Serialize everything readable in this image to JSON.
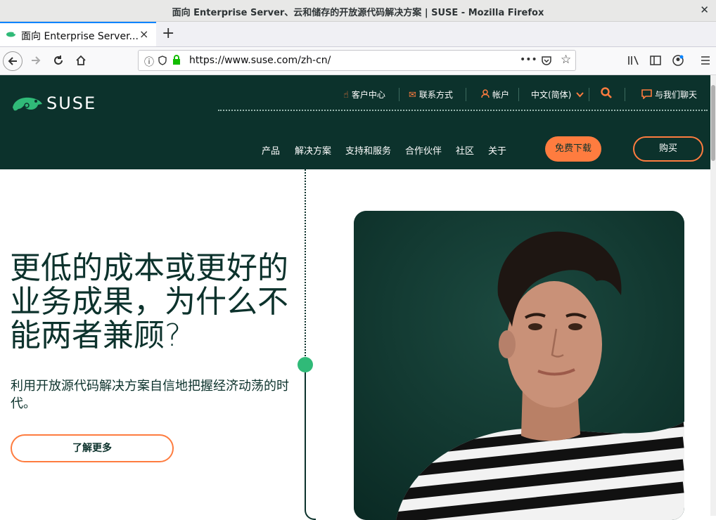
{
  "window": {
    "title": "面向 Enterprise Server、云和储存的开放源代码解决方案 | SUSE - Mozilla Firefox"
  },
  "tab": {
    "label": "面向 Enterprise Server...",
    "close": "×",
    "new": "+"
  },
  "address": {
    "url": "https://www.suse.com/zh-cn/",
    "more": "•••"
  },
  "brand": {
    "name": "SUSE"
  },
  "utility": {
    "customer_center": "客户中心",
    "contact": "联系方式",
    "account": "帐户",
    "language": "中文(简体)",
    "chat": "与我们聊天"
  },
  "nav": [
    "产品",
    "解决方案",
    "支持和服务",
    "合作伙伴",
    "社区",
    "关于"
  ],
  "buttons": {
    "free_download": "免费下载",
    "buy": "购买",
    "learn_more": "了解更多"
  },
  "hero": {
    "heading": "更低的成本或更好的业务成果，为什么不能两者兼顾?",
    "subheading": "利用开放源代码解决方案自信地把握经济动荡的时代。"
  },
  "colors": {
    "brand_dark": "#0c322c",
    "accent_orange": "#fe7c3f",
    "brand_green": "#30ba78"
  }
}
